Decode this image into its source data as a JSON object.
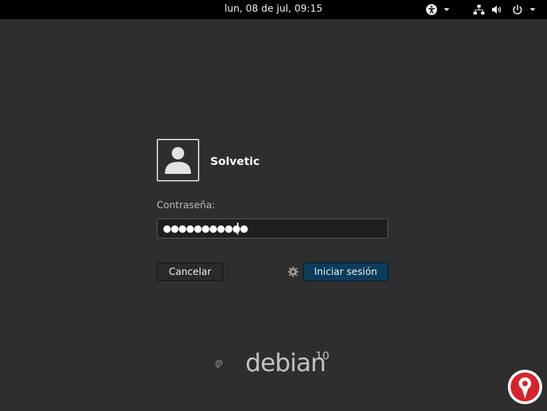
{
  "topbar": {
    "clock": "lun, 08 de jul, 09:15",
    "icons": [
      "accessibility-icon",
      "chevron-down-icon",
      "network-icon",
      "volume-icon",
      "power-icon",
      "chevron-down-icon"
    ]
  },
  "user": {
    "name": "Solvetic",
    "avatar_icon": "user-avatar-icon"
  },
  "password": {
    "label": "Contraseña:",
    "value": "●●●●●●●●●●●"
  },
  "buttons": {
    "cancel": "Cancelar",
    "login": "Iniciar sesión",
    "settings_icon": "gear-icon"
  },
  "branding": {
    "word": "debian",
    "version": "10"
  },
  "colors": {
    "background": "#2e2e2e",
    "topbar": "#000000",
    "login_button": "#0b3c5c",
    "watermark_red": "#d8232a"
  }
}
